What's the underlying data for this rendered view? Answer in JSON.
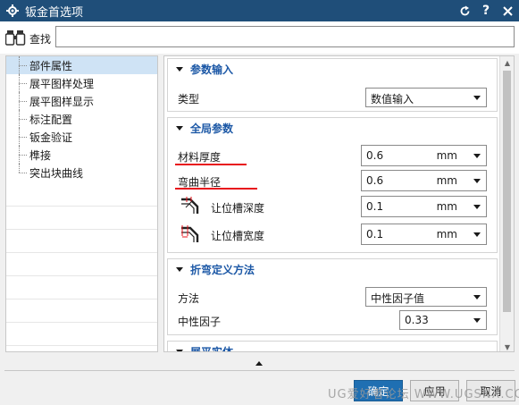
{
  "window": {
    "title": "钣金首选项",
    "buttons": [
      "reset-icon",
      "help-icon",
      "close-icon"
    ]
  },
  "find": {
    "label": "查找",
    "value": ""
  },
  "tree": {
    "items": [
      {
        "label": "部件属性",
        "selected": true
      },
      {
        "label": "展平图样处理",
        "selected": false
      },
      {
        "label": "展平图样显示",
        "selected": false
      },
      {
        "label": "标注配置",
        "selected": false
      },
      {
        "label": "钣金验证",
        "selected": false
      },
      {
        "label": "榫接",
        "selected": false
      },
      {
        "label": "突出块曲线",
        "selected": false
      }
    ]
  },
  "sections": {
    "param_input": {
      "title": "参数输入",
      "type_label": "类型",
      "type_value": "数值输入"
    },
    "global_params": {
      "title": "全局参数",
      "thickness_label": "材料厚度",
      "thickness_value": "0.6",
      "thickness_unit": "mm",
      "bend_radius_label": "弯曲半径",
      "bend_radius_value": "0.6",
      "bend_radius_unit": "mm",
      "relief_depth_label": "让位槽深度",
      "relief_depth_value": "0.1",
      "relief_depth_unit": "mm",
      "relief_width_label": "让位槽宽度",
      "relief_width_value": "0.1",
      "relief_width_unit": "mm"
    },
    "bend_def": {
      "title": "折弯定义方法",
      "method_label": "方法",
      "method_value": "中性因子值",
      "neutral_label": "中性因子",
      "neutral_value": "0.33"
    },
    "flat_solid": {
      "title": "展平实体"
    }
  },
  "footer": {
    "ok_label": "确定",
    "apply_label": "应用",
    "cancel_label": "取消",
    "watermark": "UG爱好者论坛 WWW.UGSNX.COM"
  },
  "colors": {
    "titlebar": "#1f4e79",
    "section_title": "#1c58a6",
    "highlight_underline": "#e8141c",
    "selected_item": "#cfe3f5"
  }
}
